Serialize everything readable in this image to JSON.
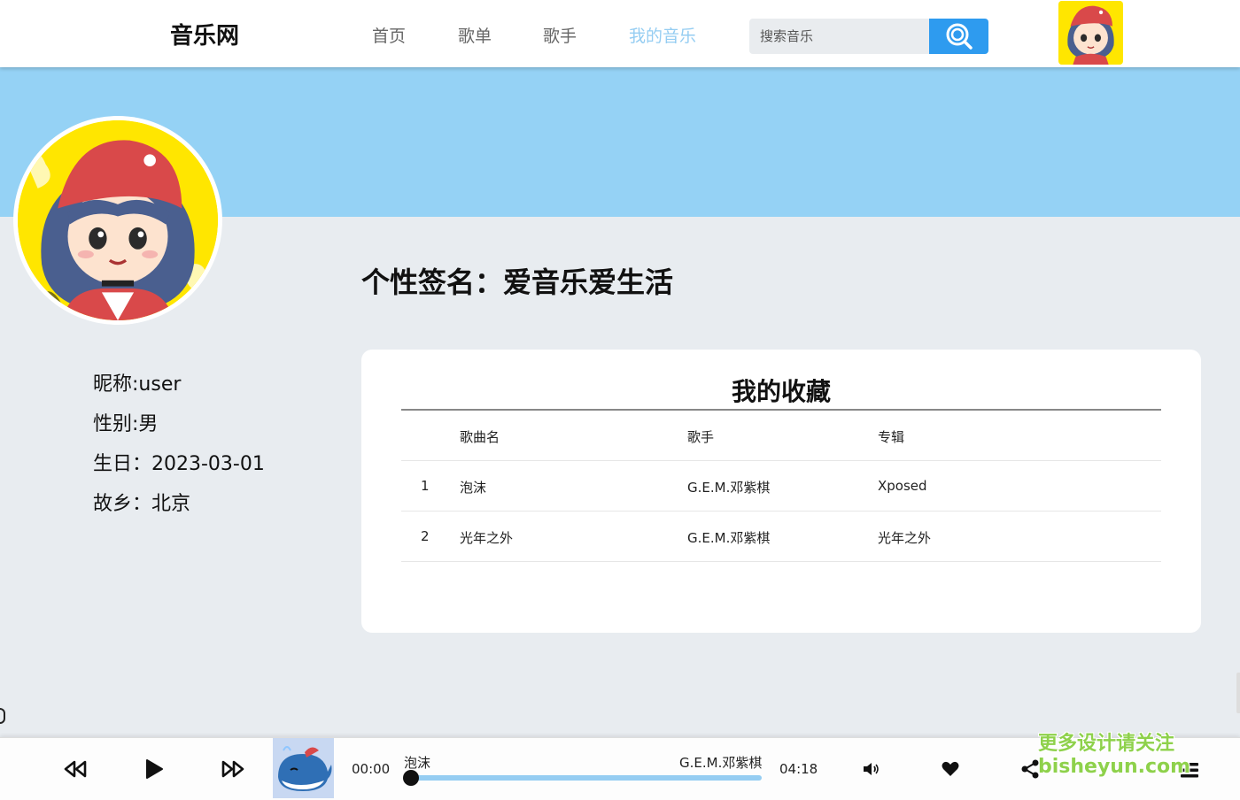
{
  "header": {
    "logo": "音乐网",
    "nav": [
      "首页",
      "歌单",
      "歌手",
      "我的音乐"
    ],
    "active_nav": "我的音乐",
    "search": {
      "placeholder": "搜索音乐"
    },
    "accent_color": "#95cdf2",
    "search_button_color": "#2e9bef"
  },
  "profile": {
    "signature": "个性签名：爱音乐爱生活",
    "nickname": "昵称:user",
    "gender": "性别:男",
    "birthday": "生日：2023-03-01",
    "hometown": "故乡：北京"
  },
  "favorites": {
    "title": "我的收藏",
    "columns": [
      "",
      "歌曲名",
      "歌手",
      "专辑"
    ],
    "rows": [
      {
        "index": "1",
        "name": "泡沫",
        "artist": "G.E.M.邓紫棋",
        "album": "Xposed"
      },
      {
        "index": "2",
        "name": "光年之外",
        "artist": "G.E.M.邓紫棋",
        "album": "光年之外"
      }
    ]
  },
  "player": {
    "current_time": "00:00",
    "total_time": "04:18",
    "song": "泡沫",
    "artist": "G.E.M.邓紫棋",
    "progress": 0,
    "icons": [
      "prev-icon",
      "play-icon",
      "next-icon",
      "volume-icon",
      "heart-icon",
      "share-icon",
      "playlist-icon"
    ]
  },
  "watermark": {
    "line1": "更多设计请关注",
    "line2": "bisheyun.com"
  }
}
